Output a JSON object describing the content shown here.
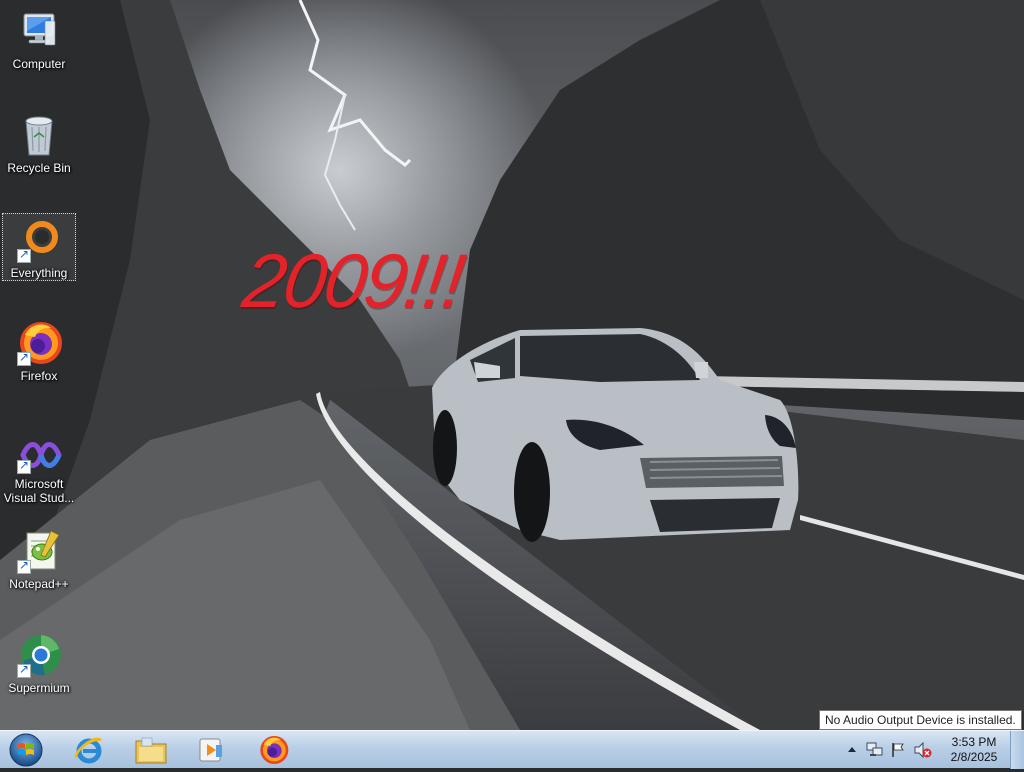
{
  "wallpaper": {
    "overlay_text": "2009!!!",
    "overlay_color": "#e3222a"
  },
  "desktop": {
    "icons": [
      {
        "label": "Computer",
        "icon": "computer-icon",
        "shortcut": false,
        "selected": false
      },
      {
        "label": "Recycle Bin",
        "icon": "recycle-bin-icon",
        "shortcut": false,
        "selected": false
      },
      {
        "label": "Everything",
        "icon": "everything-icon",
        "shortcut": true,
        "selected": true
      },
      {
        "label": "Firefox",
        "icon": "firefox-icon",
        "shortcut": true,
        "selected": false
      },
      {
        "label": "Microsoft Visual Stud...",
        "icon": "visual-studio-icon",
        "shortcut": true,
        "selected": false
      },
      {
        "label": "Notepad++",
        "icon": "notepad-plus-plus-icon",
        "shortcut": true,
        "selected": false
      },
      {
        "label": "Supermium",
        "icon": "supermium-icon",
        "shortcut": true,
        "selected": false
      }
    ]
  },
  "taskbar": {
    "pinned": [
      {
        "icon": "internet-explorer-icon"
      },
      {
        "icon": "file-explorer-icon"
      },
      {
        "icon": "media-player-icon"
      },
      {
        "icon": "firefox-icon"
      }
    ],
    "tray": {
      "icons": [
        "show-hidden-icons-icon",
        "network-icon",
        "action-center-flag-icon",
        "volume-muted-icon"
      ],
      "time": "3:53 PM",
      "date": "2/8/2025"
    },
    "colors": {
      "accent": "#a7c1de"
    }
  },
  "tooltip": {
    "text": "No Audio Output Device is installed."
  }
}
